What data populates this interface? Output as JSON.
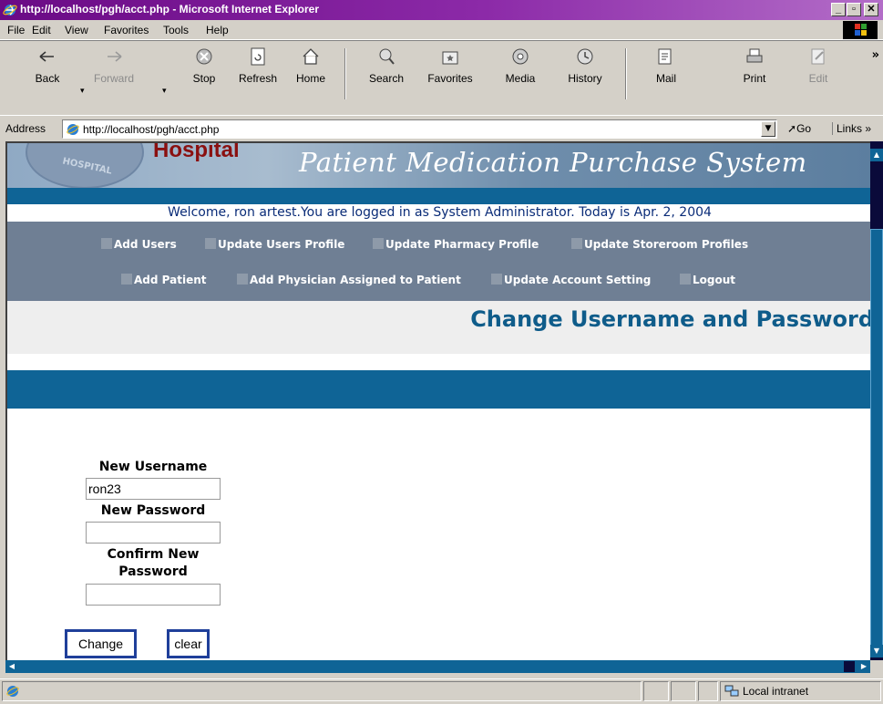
{
  "window": {
    "title": "http://localhost/pgh/acct.php - Microsoft Internet Explorer",
    "controls": {
      "minimize": "_",
      "maximize": "▫",
      "close": "✕"
    }
  },
  "menu": [
    "File",
    "Edit",
    "View",
    "Favorites",
    "Tools",
    "Help"
  ],
  "toolbar": {
    "back": "Back",
    "forward": "Forward",
    "stop": "Stop",
    "refresh": "Refresh",
    "home": "Home",
    "search": "Search",
    "favorites": "Favorites",
    "media": "Media",
    "history": "History",
    "mail": "Mail",
    "print": "Print",
    "edit": "Edit",
    "more": "»"
  },
  "address": {
    "label": "Address",
    "url": "http://localhost/pgh/acct.php",
    "go": "Go",
    "links": "Links »"
  },
  "site": {
    "hospital_text": "Hospital",
    "seal_text": "HOSPITAL",
    "system_title": "Patient Medication Purchase System",
    "welcome": "Welcome, ron  artest.You are logged in as System Administrator. Today is Apr. 2, 2004",
    "nav_row1": [
      "Add Users",
      "Update Users Profile",
      "Update Pharmacy Profile",
      "Update Storeroom Profiles"
    ],
    "nav_row2": [
      "Add Patient",
      "Add Physician Assigned to Patient",
      "Update Account Setting",
      "Logout"
    ],
    "page_heading": "Change Username and Password"
  },
  "form": {
    "new_username_label": "New Username",
    "new_username_value": "ron23",
    "new_password_label": "New Password",
    "new_password_value": "",
    "confirm_label_line1": "Confirm New",
    "confirm_label_line2": "Password",
    "confirm_value": "",
    "change_button": "Change",
    "clear_button": "clear"
  },
  "status": {
    "zone": "Local intranet"
  },
  "colors": {
    "titlebar": "#6a0a85",
    "site_blue": "#0f6496",
    "nav_gray": "#6f7f94",
    "heading_blue": "#0f5c8a",
    "welcome_text": "#0a2c78",
    "button_border": "#1f3f9a"
  }
}
